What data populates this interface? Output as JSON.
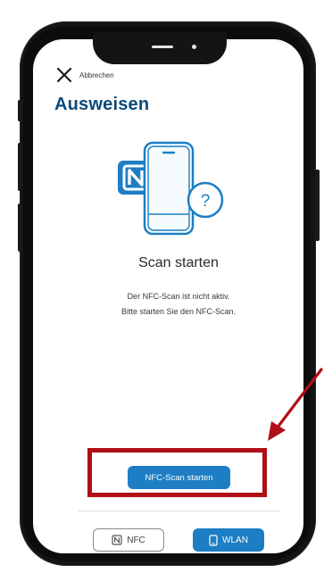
{
  "header": {
    "cancel_label": "Abbrechen",
    "title": "Ausweisen"
  },
  "main": {
    "heading": "Scan starten",
    "description_line1": "Der NFC-Scan ist nicht aktiv.",
    "description_line2": "Bitte starten Sie den NFC-Scan.",
    "primary_button_label": "NFC-Scan starten",
    "illustration_badge": "?"
  },
  "footer": {
    "tabs": [
      {
        "label": "NFC",
        "icon": "nfc-icon",
        "active": false
      },
      {
        "label": "WLAN",
        "icon": "phone-icon",
        "active": true
      }
    ]
  },
  "colors": {
    "brand_blue": "#1d7ec4",
    "title_blue": "#0b4a7a",
    "highlight_red": "#b10e16"
  }
}
